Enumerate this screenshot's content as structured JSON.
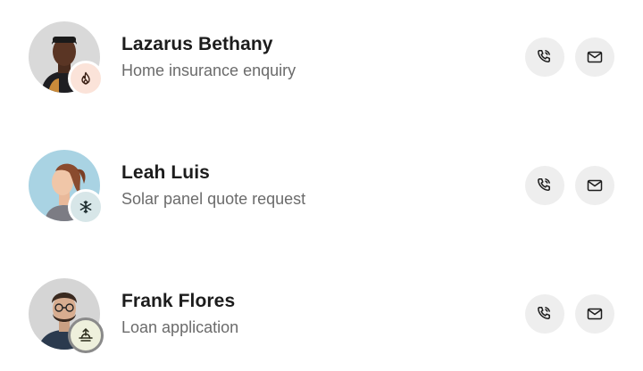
{
  "contacts": [
    {
      "name": "Lazarus Bethany",
      "subtitle": "Home insurance enquiry",
      "status_icon": "flame-icon",
      "avatar_bg": "#d9d9d9",
      "badge_bg": "#fbe3d9",
      "badge_color": "#3a1f14"
    },
    {
      "name": "Leah Luis",
      "subtitle": "Solar panel quote request",
      "status_icon": "snowflake-icon",
      "avatar_bg": "#a9d3e3",
      "badge_bg": "#d7e6e8",
      "badge_color": "#1b2a2c"
    },
    {
      "name": "Frank Flores",
      "subtitle": "Loan application",
      "status_icon": "sunrise-icon",
      "avatar_bg": "#d5d5d5",
      "badge_bg": "#eef0dc",
      "badge_color": "#2a2a1a"
    }
  ],
  "actions": {
    "call_icon": "phone-icon",
    "email_icon": "mail-icon"
  }
}
